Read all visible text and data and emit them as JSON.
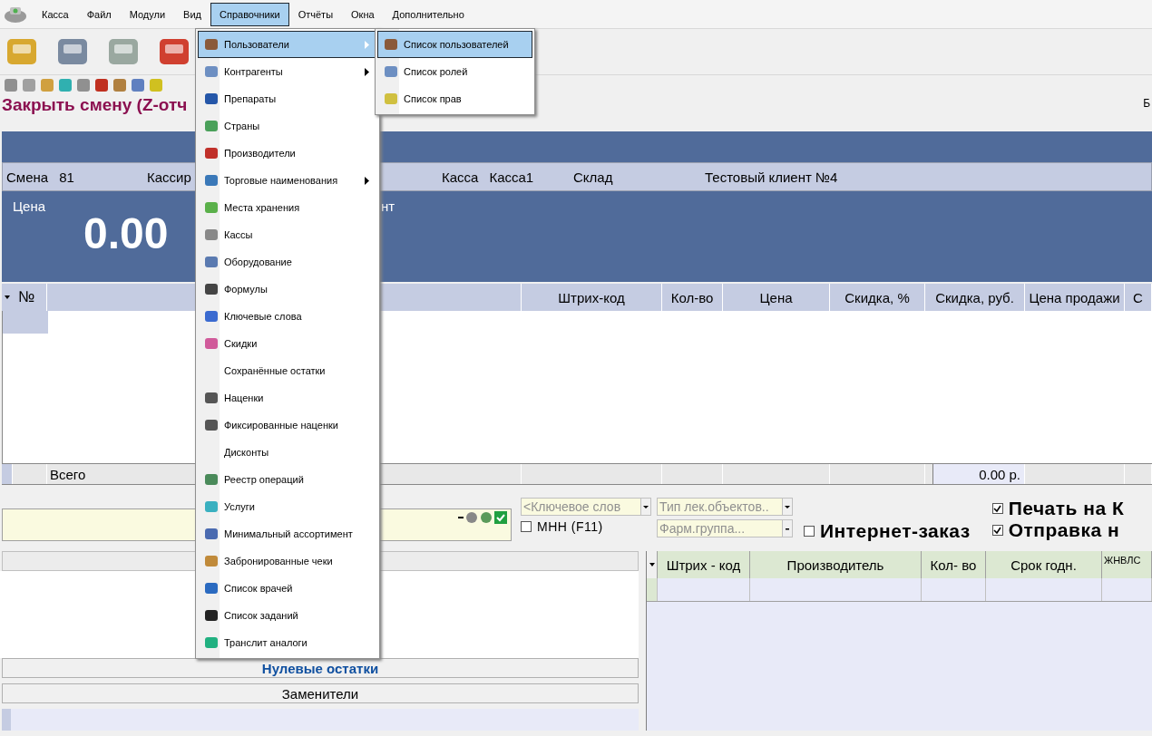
{
  "menu_bar": {
    "items": [
      {
        "label": "Касса",
        "selected": false
      },
      {
        "label": "Файл",
        "selected": false
      },
      {
        "label": "Модули",
        "selected": false
      },
      {
        "label": "Вид",
        "selected": false
      },
      {
        "label": "Справочники",
        "selected": true
      },
      {
        "label": "Отчёты",
        "selected": false
      },
      {
        "label": "Окна",
        "selected": false
      },
      {
        "label": "Дополнительно",
        "selected": false
      }
    ]
  },
  "page_title": "Закрыть смену (Z-отч",
  "corner_text": "Б",
  "info_row": [
    {
      "label": "Смена",
      "value": "81"
    },
    {
      "label": "Кассир"
    },
    {
      "label": "Касса",
      "value": "Касса1"
    },
    {
      "label": "Склад"
    },
    {
      "label": "Тестовый клиент №4"
    }
  ],
  "price_panel": {
    "label": "Цена",
    "value": "0.00",
    "second_label": "нт"
  },
  "table": {
    "columns": [
      "№",
      "Штрих-код",
      "Кол-во",
      "Цена",
      "Скидка, %",
      "Скидка, руб.",
      "Цена продажи",
      "С"
    ]
  },
  "totals": {
    "label": "Всего",
    "sum": "0.00 р."
  },
  "filters": {
    "keyword": {
      "placeholder": "<Ключевое слов"
    },
    "type": {
      "placeholder": "Тип лек.объектов.."
    },
    "pharm_group": {
      "placeholder": "Фарм.группа..."
    },
    "checkboxes": [
      {
        "label": "МНН (F11)",
        "checked": false
      },
      {
        "label": "Интернет-заказ",
        "checked": false
      },
      {
        "label": "Печать на К",
        "checked": true
      },
      {
        "label": "Отправка н",
        "checked": true
      }
    ]
  },
  "left_buttons": [
    "Нулевые остатки",
    "Заменители"
  ],
  "stock_table": {
    "columns": [
      "Штрих - код",
      "Производитель",
      "Кол- во",
      "Срок годн.",
      "ЖНВЛС"
    ]
  },
  "dropdown": {
    "items": [
      {
        "label": "Пользователи",
        "selected": true,
        "has_submenu": true,
        "has_icon": true
      },
      {
        "label": "Контрагенты",
        "selected": false,
        "has_submenu": true,
        "has_icon": true
      },
      {
        "label": "Препараты",
        "selected": false,
        "has_submenu": false,
        "has_icon": true
      },
      {
        "label": "Страны",
        "selected": false,
        "has_submenu": false,
        "has_icon": true
      },
      {
        "label": "Производители",
        "selected": false,
        "has_submenu": false,
        "has_icon": true
      },
      {
        "label": "Торговые наименования",
        "selected": false,
        "has_submenu": true,
        "has_icon": true
      },
      {
        "label": "Места хранения",
        "selected": false,
        "has_submenu": false,
        "has_icon": true
      },
      {
        "label": "Кассы",
        "selected": false,
        "has_submenu": false,
        "has_icon": true
      },
      {
        "label": "Оборудование",
        "selected": false,
        "has_submenu": false,
        "has_icon": true
      },
      {
        "label": "Формулы",
        "selected": false,
        "has_submenu": false,
        "has_icon": true
      },
      {
        "label": "Ключевые слова",
        "selected": false,
        "has_submenu": false,
        "has_icon": true
      },
      {
        "label": "Скидки",
        "selected": false,
        "has_submenu": false,
        "has_icon": true
      },
      {
        "label": "Сохранённые остатки",
        "selected": false,
        "has_submenu": false,
        "has_icon": false
      },
      {
        "label": "Наценки",
        "selected": false,
        "has_submenu": false,
        "has_icon": true
      },
      {
        "label": "Фиксированные наценки",
        "selected": false,
        "has_submenu": false,
        "has_icon": true
      },
      {
        "label": "Дисконты",
        "selected": false,
        "has_submenu": false,
        "has_icon": false
      },
      {
        "label": "Реестр операций",
        "selected": false,
        "has_submenu": false,
        "has_icon": true
      },
      {
        "label": "Услуги",
        "selected": false,
        "has_submenu": false,
        "has_icon": true
      },
      {
        "label": "Минимальный ассортимент",
        "selected": false,
        "has_submenu": false,
        "has_icon": true
      },
      {
        "label": "Забронированные чеки",
        "selected": false,
        "has_submenu": false,
        "has_icon": true
      },
      {
        "label": "Список врачей",
        "selected": false,
        "has_submenu": false,
        "has_icon": true
      },
      {
        "label": "Список заданий",
        "selected": false,
        "has_submenu": false,
        "has_icon": true
      },
      {
        "label": "Транслит аналоги",
        "selected": false,
        "has_submenu": false,
        "has_icon": true
      }
    ]
  },
  "submenu": {
    "items": [
      {
        "label": "Список пользователей",
        "selected": true
      },
      {
        "label": "Список ролей",
        "selected": false
      },
      {
        "label": "Список прав",
        "selected": false
      }
    ]
  }
}
